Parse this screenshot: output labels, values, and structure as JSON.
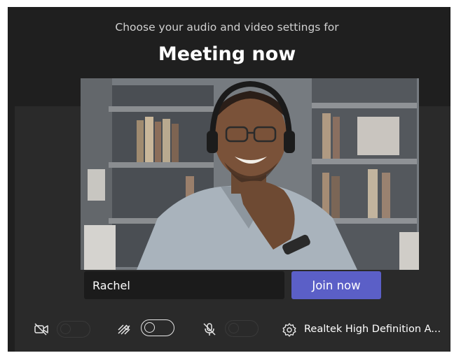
{
  "header": {
    "subtitle": "Choose your audio and video settings for",
    "meeting_title": "Meeting now"
  },
  "join_form": {
    "name_value": "Rachel",
    "join_label": "Join now"
  },
  "controls": {
    "camera": {
      "icon": "camera-off-icon",
      "enabled": false
    },
    "background_blur": {
      "icon": "background-blur-icon",
      "enabled": false
    },
    "microphone": {
      "icon": "mic-off-icon",
      "enabled": false
    },
    "audio_device": {
      "icon": "gear-icon",
      "label": "Realtek High Definition A..."
    }
  },
  "colors": {
    "panel": "#1f1f1f",
    "accent": "#5b5fc7",
    "field": "#1b1b1b"
  }
}
